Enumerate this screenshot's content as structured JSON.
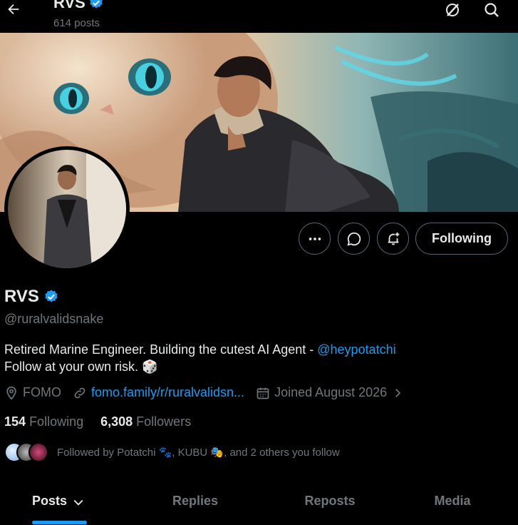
{
  "header": {
    "title": "RVS",
    "post_count": "614 posts"
  },
  "actions": {
    "following_label": "Following"
  },
  "profile": {
    "name": "RVS",
    "handle": "@ruralvalidsnake",
    "bio_text": "Retired Marine Engineer. Building the cutest AI Agent - ",
    "bio_mention": "@heypotatchi",
    "bio_line2": "Follow at your own risk.",
    "bio_emoji": "🎲",
    "location": "FOMO",
    "website": "fomo.family/r/ruralvalidsn...",
    "joined": "Joined August 2026",
    "following_count": "154",
    "following_label": "Following",
    "followers_count": "6,308",
    "followers_label": "Followers",
    "followed_by": "Followed by Potatchi 🐾, KUBU 🎭, and 2 others you follow"
  },
  "tabs": [
    {
      "label": "Posts",
      "active": true
    },
    {
      "label": "Replies",
      "active": false
    },
    {
      "label": "Reposts",
      "active": false
    },
    {
      "label": "Media",
      "active": false
    }
  ],
  "colors": {
    "accent": "#1d9bf0",
    "background": "#000000",
    "muted": "#71767b",
    "text": "#e7e9ea"
  },
  "icons": [
    "back-arrow-icon",
    "verified-badge-icon",
    "grok-icon",
    "search-icon",
    "more-icon",
    "message-icon",
    "notification-add-icon",
    "location-icon",
    "link-icon",
    "calendar-icon",
    "chevron-right-icon",
    "chevron-down-icon"
  ]
}
